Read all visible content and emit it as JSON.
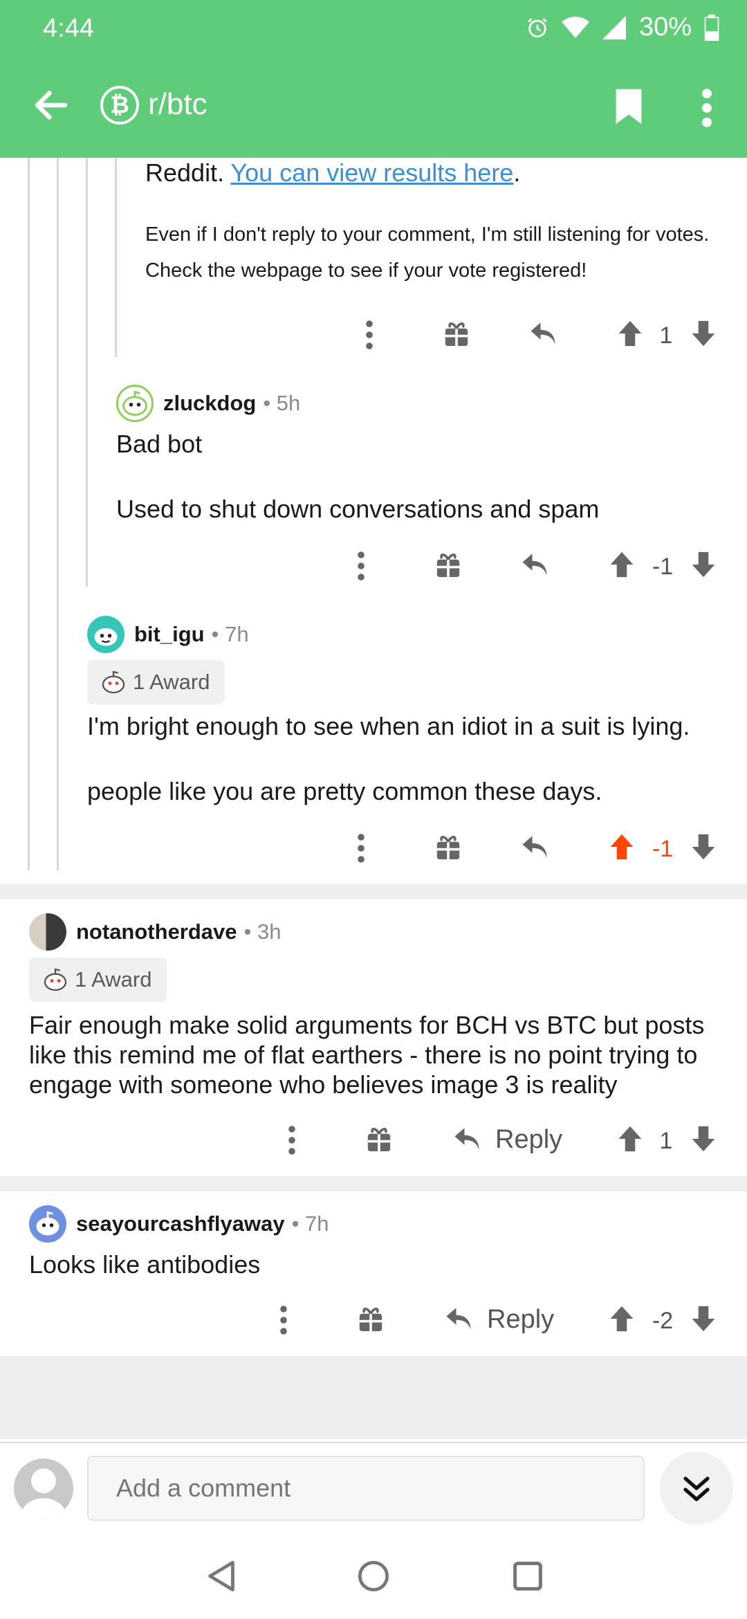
{
  "status": {
    "time": "4:44",
    "battery": "30%"
  },
  "toolbar": {
    "title": "r/btc",
    "sub_icon_glyph": "₿",
    "back_icon": "arrow-left-icon",
    "bookmark_icon": "bookmark-icon",
    "more_icon": "more-vert-icon"
  },
  "bot_comment": {
    "line1_prefix": "Reddit. ",
    "link_text": "You can view results here",
    "line1_suffix": ".",
    "line2": "Even if I don't reply to your comment, I'm still listening for votes.",
    "line3": "Check the webpage to see if your vote registered!",
    "score": "1"
  },
  "comments": [
    {
      "author": "zluckdog",
      "age": "• 5h",
      "text1": "Bad bot",
      "text2": "Used to shut down conversations and spam",
      "score": "-1"
    },
    {
      "author": "bit_igu",
      "age": "• 7h",
      "award": "1 Award",
      "text1": "I'm bright enough to see when an idiot in a suit is lying.",
      "text2": "people like you are pretty common these days.",
      "score": "-1",
      "upvoted": true
    },
    {
      "author": "notanotherdave",
      "age": "• 3h",
      "award": "1 Award",
      "text1": "Fair enough make solid arguments for BCH vs BTC but posts",
      "text2": "like this remind me of flat earthers - there is no point trying to",
      "text3": "engage with someone who believes image 3 is reality",
      "reply": "Reply",
      "score": "1"
    },
    {
      "author": "seayourcashflyaway",
      "age": "• 7h",
      "text1": "Looks like antibodies",
      "reply": "Reply",
      "score": "-2"
    }
  ],
  "compose": {
    "placeholder": "Add a comment"
  },
  "colors": {
    "brand": "#5fcc7a",
    "upvote": "#ff4500",
    "link": "#3a8fd6"
  }
}
